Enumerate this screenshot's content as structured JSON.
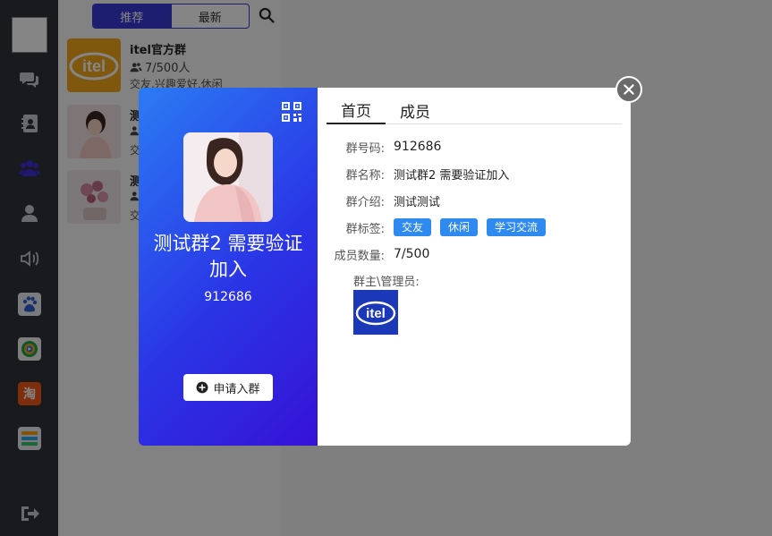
{
  "list": {
    "tabs": [
      {
        "label": "推荐",
        "active": true
      },
      {
        "label": "最新",
        "active": false
      }
    ],
    "groups": [
      {
        "name": "itel官方群",
        "count": "7/500人",
        "tags": "交友,兴趣爱好,休闲"
      },
      {
        "name": "测",
        "count": "",
        "tags": "交"
      },
      {
        "name": "测",
        "count": "",
        "tags": "交"
      }
    ]
  },
  "modal": {
    "group_name": "测试群2 需要验证加入",
    "group_id": "912686",
    "join_label": "申请入群",
    "tabs": [
      {
        "label": "首页",
        "active": true
      },
      {
        "label": "成员",
        "active": false
      }
    ],
    "fields": {
      "id_label": "群号码:",
      "id_value": "912686",
      "name_label": "群名称:",
      "name_value": "测试群2 需要验证加入",
      "intro_label": "群介绍:",
      "intro_value": "测试测试",
      "tags_label": "群标签:",
      "tags": [
        "交友",
        "休闲",
        "学习交流"
      ],
      "members_label": "成员数量:",
      "members_value": "7/500",
      "owner_label": "群主\\管理员:"
    }
  },
  "colors": {
    "accent": "#3a3ad8",
    "tag_blue": "#2f8af0",
    "nav_bg": "#2e3238",
    "gradient_start": "#2b7bf3",
    "gradient_end": "#3612d6"
  },
  "icons": {
    "nav": [
      "chat-icon",
      "contacts-icon",
      "group-icon",
      "user-icon",
      "speaker-icon",
      "baidu-app-icon",
      "tencent-video-app-icon",
      "taobao-app-icon",
      "stack-app-icon",
      "logout-icon"
    ],
    "modal": [
      "qrcode-icon",
      "plus-circle-icon",
      "close-icon"
    ]
  }
}
